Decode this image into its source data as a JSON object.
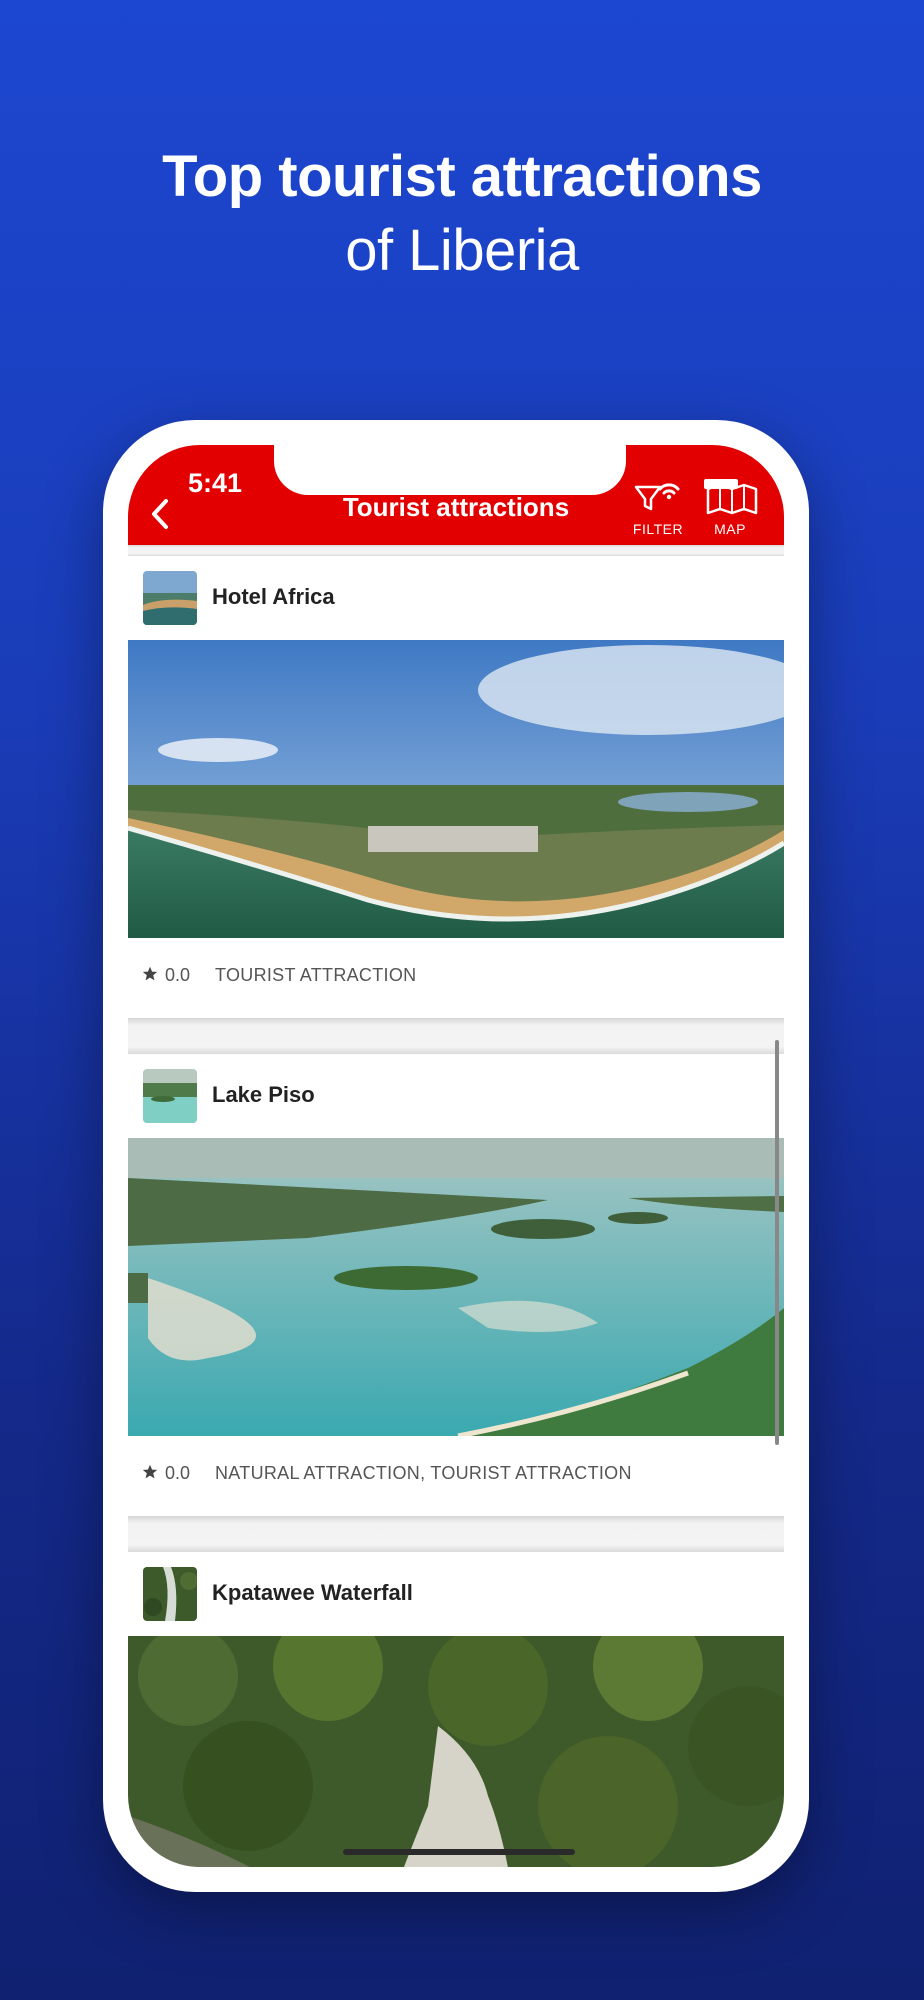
{
  "headline": {
    "line1": "Top tourist attractions",
    "line2": "of Liberia"
  },
  "status_bar": {
    "time": "5:41"
  },
  "navbar": {
    "title": "Tourist attractions",
    "filter_label": "FILTER",
    "map_label": "MAP",
    "background_color": "#e20000"
  },
  "attractions": [
    {
      "name": "Hotel Africa",
      "rating": "0.0",
      "category": "TOURIST ATTRACTION"
    },
    {
      "name": "Lake Piso",
      "rating": "0.0",
      "category": "NATURAL ATTRACTION, TOURIST ATTRACTION"
    },
    {
      "name": "Kpatawee Waterfall"
    }
  ],
  "icons": [
    "back-chevron-icon",
    "filter-icon",
    "wifi-icon",
    "map-icon",
    "star-icon"
  ]
}
